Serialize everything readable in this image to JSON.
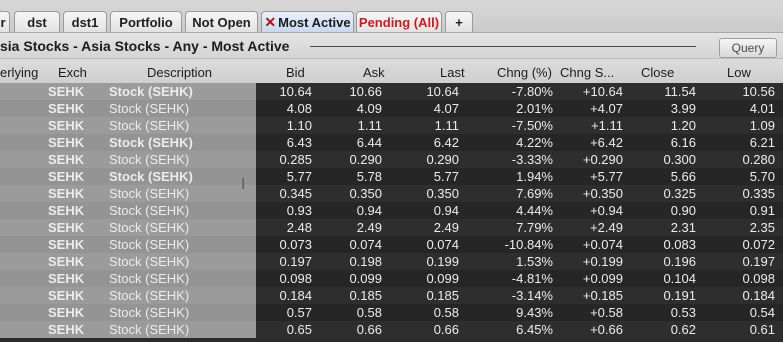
{
  "tabs": [
    {
      "label": "r"
    },
    {
      "label": "dst"
    },
    {
      "label": "dst1"
    },
    {
      "label": "Portfolio"
    },
    {
      "label": "Not Open"
    },
    {
      "label": "Most Active",
      "closable": true
    },
    {
      "label": "Pending (All)"
    },
    {
      "label": "+"
    }
  ],
  "header": {
    "title": "sia Stocks - Asia Stocks - Any - Most Active",
    "query_label": "Query"
  },
  "columns": [
    "erlying",
    "Exch",
    "Description",
    "Bid",
    "Ask",
    "Last",
    "Chng (%)",
    "Chng S...",
    "Close",
    "Low"
  ],
  "rows": [
    {
      "exch": "SEHK",
      "desc": "Stock (SEHK)",
      "bid": "10.64",
      "ask": "10.66",
      "last": "10.64",
      "chg_pct": "-7.80%",
      "chg": "+10.64",
      "close": "11.54",
      "low": "10.56"
    },
    {
      "exch": "SEHK",
      "desc": "Stock (SEHK)",
      "bid": "4.08",
      "ask": "4.09",
      "last": "4.07",
      "chg_pct": "2.01%",
      "chg": "+4.07",
      "close": "3.99",
      "low": "4.01"
    },
    {
      "exch": "SEHK",
      "desc": "Stock (SEHK)",
      "bid": "1.10",
      "ask": "1.11",
      "last": "1.11",
      "chg_pct": "-7.50%",
      "chg": "+1.11",
      "close": "1.20",
      "low": "1.09"
    },
    {
      "exch": "SEHK",
      "desc": "Stock (SEHK)",
      "bid": "6.43",
      "ask": "6.44",
      "last": "6.42",
      "chg_pct": "4.22%",
      "chg": "+6.42",
      "close": "6.16",
      "low": "6.21"
    },
    {
      "exch": "SEHK",
      "desc": "Stock (SEHK)",
      "bid": "0.285",
      "ask": "0.290",
      "last": "0.290",
      "chg_pct": "-3.33%",
      "chg": "+0.290",
      "close": "0.300",
      "low": "0.280"
    },
    {
      "exch": "SEHK",
      "desc": "Stock (SEHK)",
      "bid": "5.77",
      "ask": "5.78",
      "last": "5.77",
      "chg_pct": "1.94%",
      "chg": "+5.77",
      "close": "5.66",
      "low": "5.70"
    },
    {
      "exch": "SEHK",
      "desc": "Stock (SEHK)",
      "bid": "0.345",
      "ask": "0.350",
      "last": "0.350",
      "chg_pct": "7.69%",
      "chg": "+0.350",
      "close": "0.325",
      "low": "0.335"
    },
    {
      "exch": "SEHK",
      "desc": "Stock (SEHK)",
      "bid": "0.93",
      "ask": "0.94",
      "last": "0.94",
      "chg_pct": "4.44%",
      "chg": "+0.94",
      "close": "0.90",
      "low": "0.91"
    },
    {
      "exch": "SEHK",
      "desc": "Stock (SEHK)",
      "bid": "2.48",
      "ask": "2.49",
      "last": "2.49",
      "chg_pct": "7.79%",
      "chg": "+2.49",
      "close": "2.31",
      "low": "2.35"
    },
    {
      "exch": "SEHK",
      "desc": "Stock (SEHK)",
      "bid": "0.073",
      "ask": "0.074",
      "last": "0.074",
      "chg_pct": "-10.84%",
      "chg": "+0.074",
      "close": "0.083",
      "low": "0.072"
    },
    {
      "exch": "SEHK",
      "desc": "Stock (SEHK)",
      "bid": "0.197",
      "ask": "0.198",
      "last": "0.199",
      "chg_pct": "1.53%",
      "chg": "+0.199",
      "close": "0.196",
      "low": "0.197"
    },
    {
      "exch": "SEHK",
      "desc": "Stock (SEHK)",
      "bid": "0.098",
      "ask": "0.099",
      "last": "0.099",
      "chg_pct": "-4.81%",
      "chg": "+0.099",
      "close": "0.104",
      "low": "0.098"
    },
    {
      "exch": "SEHK",
      "desc": "Stock (SEHK)",
      "bid": "0.184",
      "ask": "0.185",
      "last": "0.185",
      "chg_pct": "-3.14%",
      "chg": "+0.185",
      "close": "0.191",
      "low": "0.184"
    },
    {
      "exch": "SEHK",
      "desc": "Stock (SEHK)",
      "bid": "0.57",
      "ask": "0.58",
      "last": "0.58",
      "chg_pct": "9.43%",
      "chg": "+0.58",
      "close": "0.53",
      "low": "0.54"
    },
    {
      "exch": "SEHK",
      "desc": "Stock (SEHK)",
      "bid": "0.65",
      "ask": "0.66",
      "last": "0.66",
      "chg_pct": "6.45%",
      "chg": "+0.66",
      "close": "0.62",
      "low": "0.61"
    }
  ],
  "colors": {
    "pending_tab": "#d2181c",
    "close_x": "#b01010",
    "grid_left_bg": "#9b9b9b",
    "grid_right_bg": "#2e2e2e",
    "text_light": "#ececec"
  },
  "icons": {
    "close_tab": "close-icon",
    "text_cursor": "i-beam-cursor-icon"
  }
}
